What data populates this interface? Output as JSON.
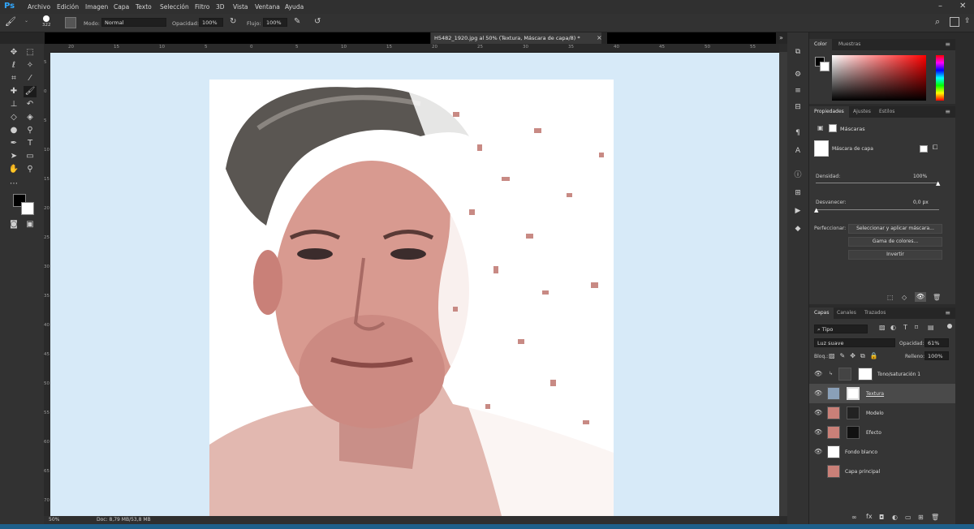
{
  "menubar": {
    "logo": "Ps",
    "items": [
      "Archivo",
      "Edición",
      "Imagen",
      "Capa",
      "Texto",
      "Selección",
      "Filtro",
      "3D",
      "Vista",
      "Ventana",
      "Ayuda"
    ],
    "win_min": "–",
    "win_close": "✕"
  },
  "options": {
    "brush_size": "322",
    "mode_label": "Modo:",
    "mode_value": "Normal",
    "opacity_label": "Opacidad:",
    "opacity_value": "100%",
    "flow_label": "Flujo:",
    "flow_value": "100%"
  },
  "document": {
    "tab_title": "H5482_1920.jpg al 50% (Textura, Máscara de capa/8) *",
    "tab_close": "×",
    "overflow": "»"
  },
  "rulers": {
    "top": [
      "20",
      "15",
      "10",
      "5",
      "0",
      "5",
      "10",
      "15",
      "20",
      "25",
      "30",
      "35",
      "40",
      "45",
      "50",
      "55"
    ],
    "left": [
      "5",
      "0",
      "5",
      "10",
      "15",
      "20",
      "25",
      "30",
      "35",
      "40",
      "45",
      "50",
      "55",
      "60",
      "65",
      "70"
    ]
  },
  "status": {
    "zoom": "50%",
    "doc": "Doc: 8,79 MB/53,8 MB"
  },
  "color_panel": {
    "tabs": [
      "Color",
      "Muestras"
    ],
    "base_hue": "#ff0000"
  },
  "properties_panel": {
    "tabs": [
      "Propiedades",
      "Ajustes",
      "Estilos"
    ],
    "section": "Máscaras",
    "mask_label": "Máscara de capa",
    "density_label": "Densidad:",
    "density_value": "100%",
    "feather_label": "Desvanecer:",
    "feather_value": "0,0 px",
    "refine_label": "Perfeccionar:",
    "btn_select_mask": "Seleccionar y aplicar máscara...",
    "btn_color_range": "Gama de colores...",
    "btn_invert": "Invertir"
  },
  "layers_panel": {
    "tabs": [
      "Capas",
      "Canales",
      "Trazados"
    ],
    "filter_kind": "Tipo",
    "blend_mode": "Luz suave",
    "opacity_label": "Opacidad:",
    "opacity_value": "61%",
    "lock_label": "Bloq.:",
    "fill_label": "Relleno:",
    "fill_value": "100%",
    "layers": [
      {
        "name": "Tono/saturación 1",
        "visible": true,
        "selected": false
      },
      {
        "name": "Textura",
        "visible": true,
        "selected": true
      },
      {
        "name": "Modelo",
        "visible": true,
        "selected": false
      },
      {
        "name": "Efecto",
        "visible": true,
        "selected": false
      },
      {
        "name": "Fondo blanco",
        "visible": true,
        "selected": false
      },
      {
        "name": "Capa principal",
        "visible": false,
        "selected": false
      }
    ],
    "footer_fx": "fx"
  }
}
